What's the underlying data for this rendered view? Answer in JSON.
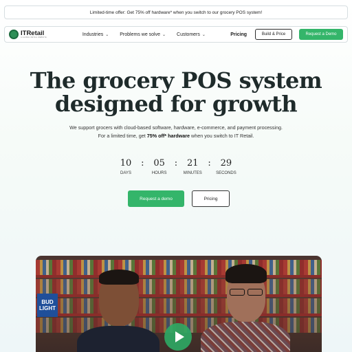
{
  "promo": {
    "text": "Limited-time offer: Get 75% off hardware* when you switch to our grocery POS system!"
  },
  "nav": {
    "logo_name": "ITRetail",
    "logo_tagline": "A GLOBAL RETAIL WEBSITE",
    "links": [
      {
        "label": "Industries",
        "icon": "chevron-down-icon"
      },
      {
        "label": "Problems we solve",
        "icon": "chevron-down-icon"
      },
      {
        "label": "Customers",
        "icon": "chevron-down-icon"
      }
    ],
    "pricing_label": "Pricing",
    "build_price_label": "Build & Price",
    "request_demo_label": "Request a Demo"
  },
  "hero": {
    "title_line1": "The grocery POS system",
    "title_line2": "designed for growth",
    "sub_line1": "We support grocers with cloud-based software, hardware, e-commerce, and payment processing.",
    "sub_line2_pre": "For a limited time, get ",
    "sub_line2_bold": "75% off* hardware",
    "sub_line2_post": " when you switch to IT Retail."
  },
  "countdown": {
    "days": "10",
    "days_label": "DAYS",
    "hours": "05",
    "hours_label": "HOURS",
    "minutes": "21",
    "minutes_label": "MINUTES",
    "seconds": "29",
    "seconds_label": "SECONDS",
    "separator": ":"
  },
  "cta": {
    "demo_label": "Request a demo",
    "pricing_label": "Pricing"
  },
  "video": {
    "sign_line1": "BUD",
    "sign_line2": "LIGHT",
    "play_icon": "play-icon"
  },
  "colors": {
    "accent_green": "#34b56a",
    "title_color": "#1f2b2b"
  }
}
